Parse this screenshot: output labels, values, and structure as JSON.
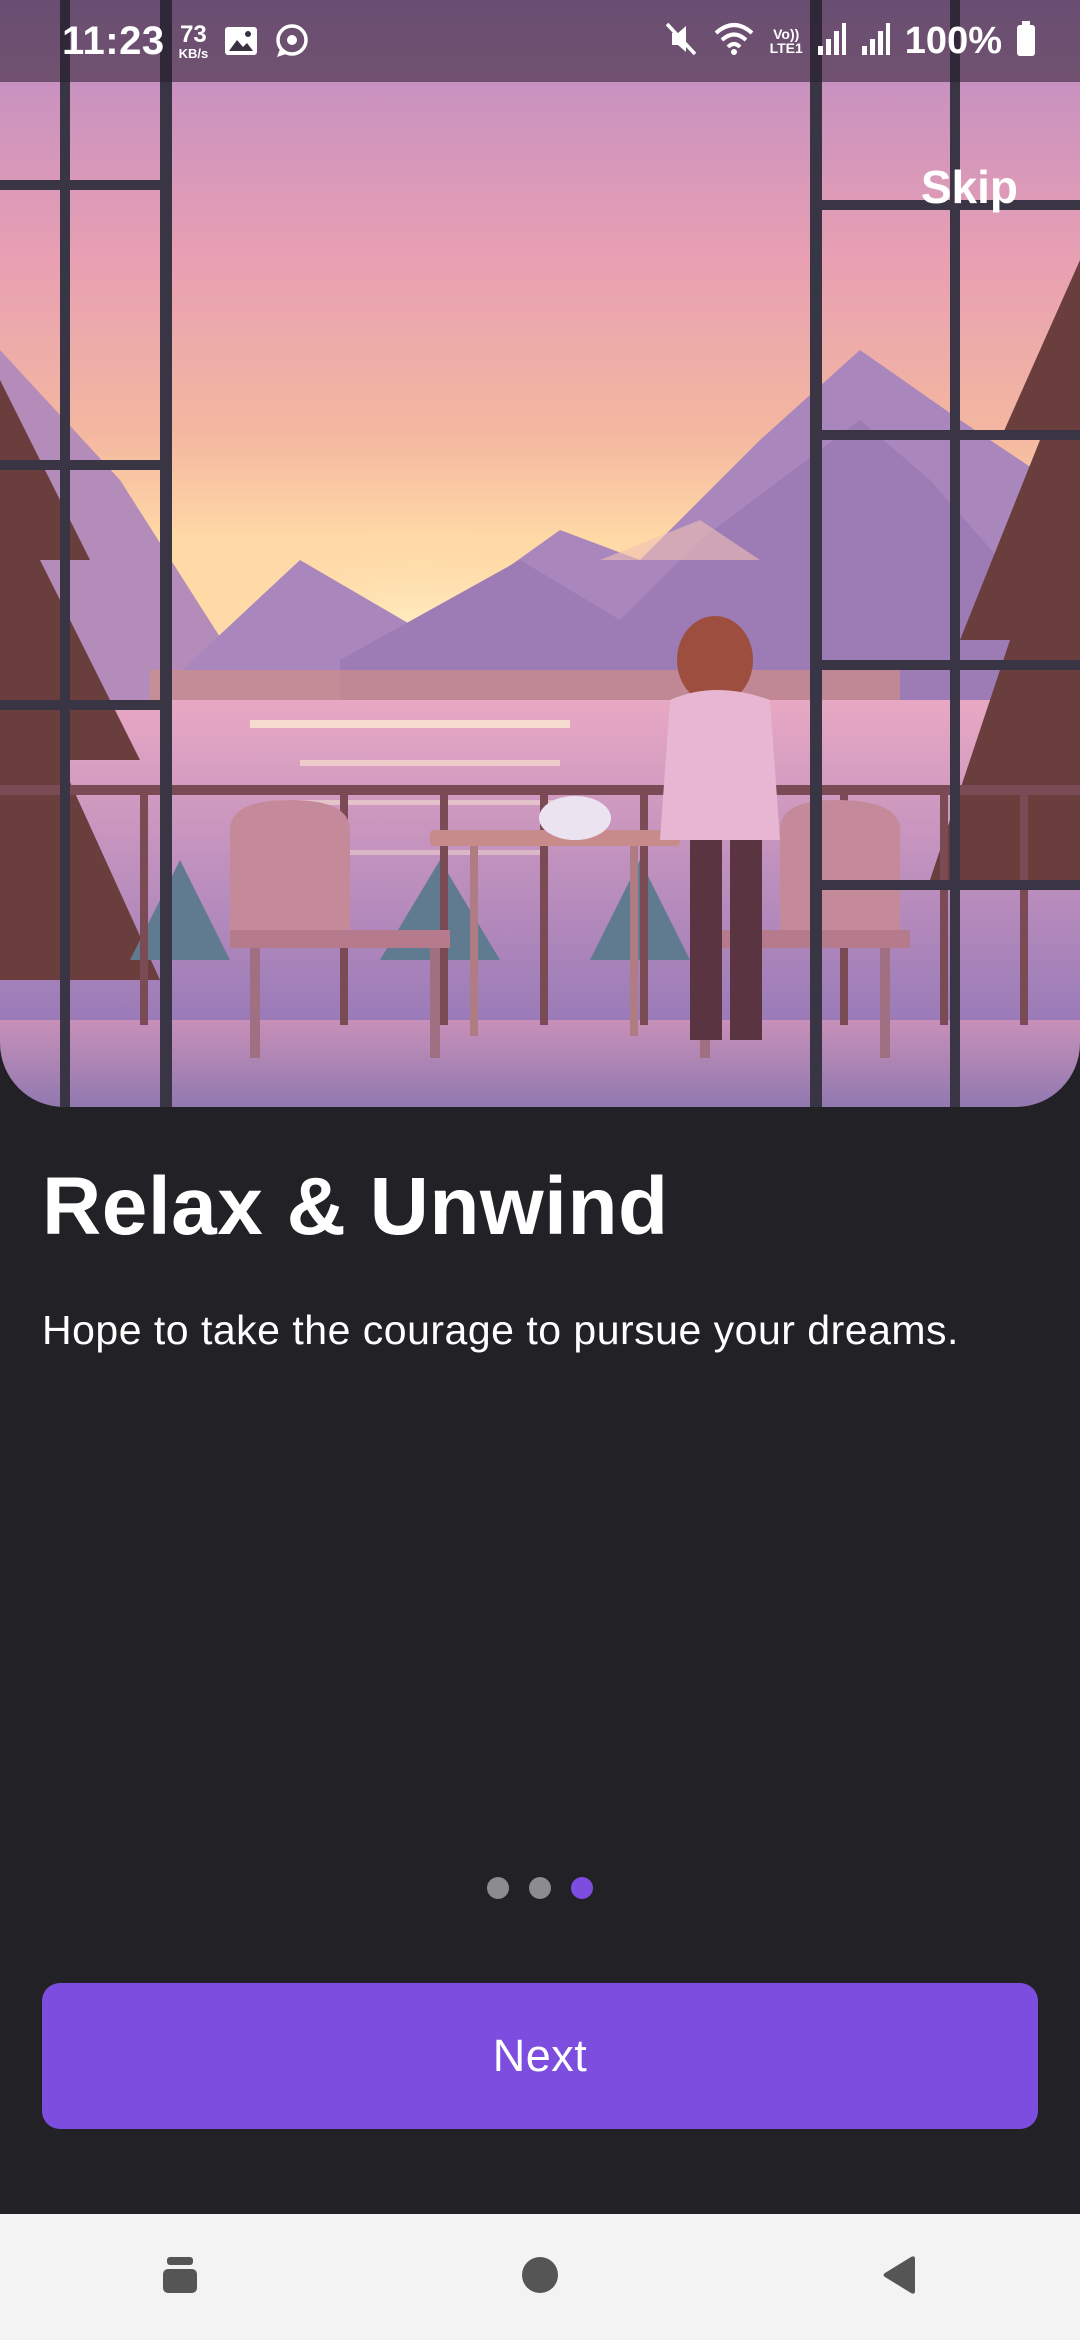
{
  "status_bar": {
    "time": "11:23",
    "net_speed_value": "73",
    "net_speed_unit": "KB/s",
    "volte_top": "Vo))",
    "volte_bottom": "LTE1",
    "battery_text": "100%"
  },
  "onboarding": {
    "skip_label": "Skip",
    "title": "Relax & Unwind",
    "description": "Hope to take the courage to pursue your dreams.",
    "page_count": 3,
    "current_page": 3,
    "next_label": "Next"
  },
  "colors": {
    "accent": "#7c4ddf",
    "background": "#212126",
    "dot_inactive": "#8b8b90"
  },
  "icons": {
    "status": [
      "gallery-icon",
      "whatsapp-icon",
      "mute-icon",
      "wifi-icon",
      "signal-icon",
      "battery-icon"
    ],
    "nav": [
      "recent-apps-icon",
      "home-icon",
      "back-icon"
    ]
  }
}
